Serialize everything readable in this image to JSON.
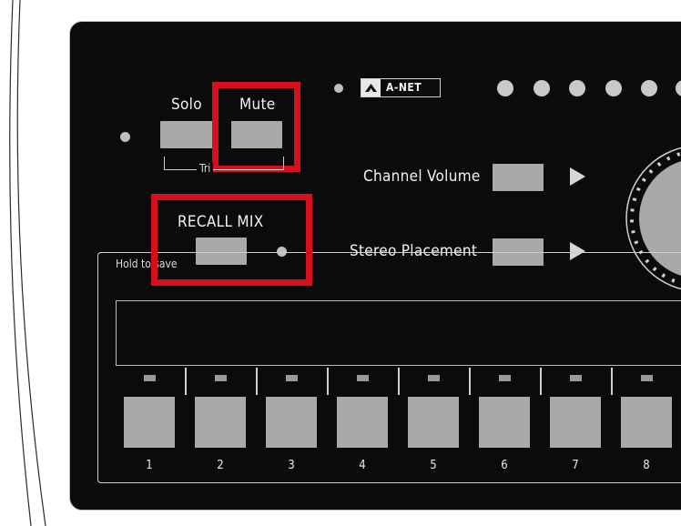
{
  "labels": {
    "solo": "Solo",
    "mute": "Mute",
    "tri": "Tri",
    "recall_mix": "RECALL MIX",
    "hold_to_save": "Hold to save",
    "channel_volume": "Channel Volume",
    "stereo_placement": "Stereo Placement"
  },
  "brand": {
    "name": "A-NET"
  },
  "pads": [
    "1",
    "2",
    "3",
    "4",
    "5",
    "6",
    "7",
    "8"
  ],
  "colors": {
    "highlight": "#d60f1c",
    "panel": "#0b0b0b",
    "button": "#a9a9a9"
  }
}
